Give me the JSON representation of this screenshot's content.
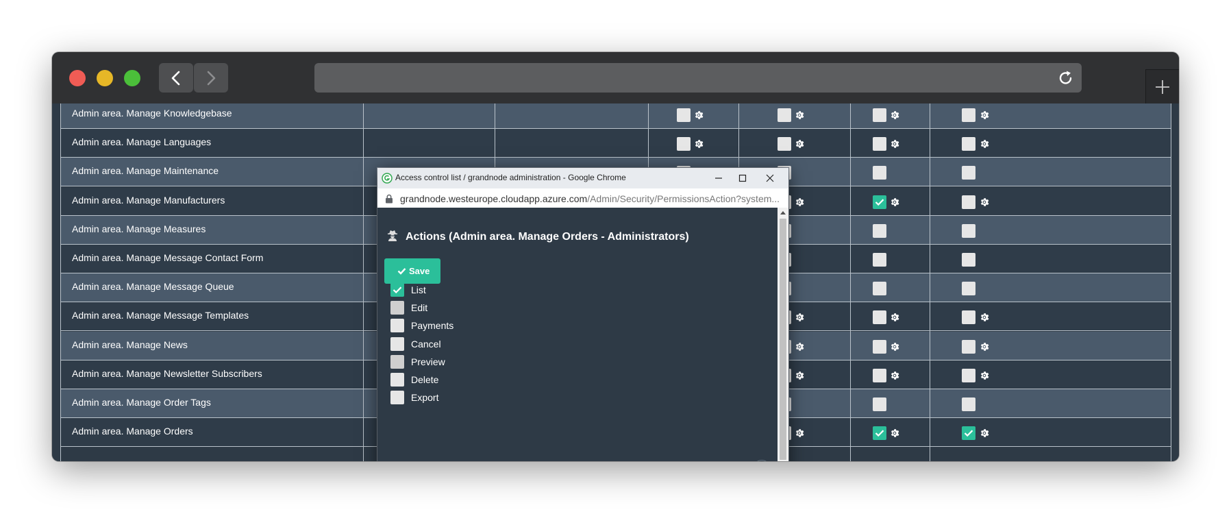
{
  "browser": {
    "url": "",
    "icons": [
      "back-arrow-icon",
      "forward-arrow-icon",
      "reload-icon",
      "new-tab-plus-icon"
    ]
  },
  "table": {
    "rows": [
      {
        "label": "Admin area. Manage Knowledgebase",
        "cells": [
          "",
          "",
          "gear",
          "gear",
          "gear",
          "gear"
        ]
      },
      {
        "label": "Admin area. Manage Languages",
        "cells": [
          "",
          "",
          "gear",
          "gear",
          "gear",
          "gear"
        ]
      },
      {
        "label": "Admin area. Manage Maintenance",
        "cells": [
          "",
          "",
          "plain",
          "plain",
          "plain",
          "plain"
        ]
      },
      {
        "label": "Admin area. Manage Manufacturers",
        "cells": [
          "",
          "",
          "gear",
          "gear",
          "checked-gear",
          "gear"
        ]
      },
      {
        "label": "Admin area. Manage Measures",
        "cells": [
          "",
          "",
          "plain",
          "plain",
          "plain",
          "plain"
        ]
      },
      {
        "label": "Admin area. Manage Message Contact Form",
        "cells": [
          "",
          "",
          "plain",
          "plain",
          "plain",
          "plain"
        ]
      },
      {
        "label": "Admin area. Manage Message Queue",
        "cells": [
          "",
          "",
          "plain",
          "plain",
          "plain",
          "plain"
        ]
      },
      {
        "label": "Admin area. Manage Message Templates",
        "cells": [
          "",
          "",
          "gear",
          "gear",
          "gear",
          "gear"
        ]
      },
      {
        "label": "Admin area. Manage News",
        "cells": [
          "",
          "",
          "gear",
          "gear",
          "gear",
          "gear"
        ]
      },
      {
        "label": "Admin area. Manage Newsletter Subscribers",
        "cells": [
          "",
          "",
          "gear",
          "gear",
          "gear",
          "gear"
        ]
      },
      {
        "label": "Admin area. Manage Order Tags",
        "cells": [
          "",
          "",
          "plain",
          "plain",
          "plain",
          "plain"
        ]
      },
      {
        "label": "Admin area. Manage Orders",
        "cells": [
          "checked-gear",
          "gear",
          "gear",
          "gear",
          "checked-gear",
          "checked-gear"
        ]
      }
    ]
  },
  "popup": {
    "window_title": "Access control list / grandnode administration - Google Chrome",
    "url_host": "grandnode.westeurope.cloudapp.azure.com",
    "url_path": "/Admin/Security/PermissionsAction?system...",
    "heading": "Actions (Admin area. Manage Orders - Administrators)",
    "save_label": "Save",
    "options": [
      {
        "label": "List",
        "checked": true
      },
      {
        "label": "Edit",
        "checked": false
      },
      {
        "label": "Payments",
        "checked": false
      },
      {
        "label": "Cancel",
        "checked": false
      },
      {
        "label": "Preview",
        "checked": false
      },
      {
        "label": "Delete",
        "checked": false
      },
      {
        "label": "Export",
        "checked": false
      }
    ]
  },
  "colors": {
    "accent": "#2bbf9a",
    "row_alt": "#4a5a6b",
    "row_base": "#2f3c49",
    "panel_bg": "#2e3a46"
  }
}
